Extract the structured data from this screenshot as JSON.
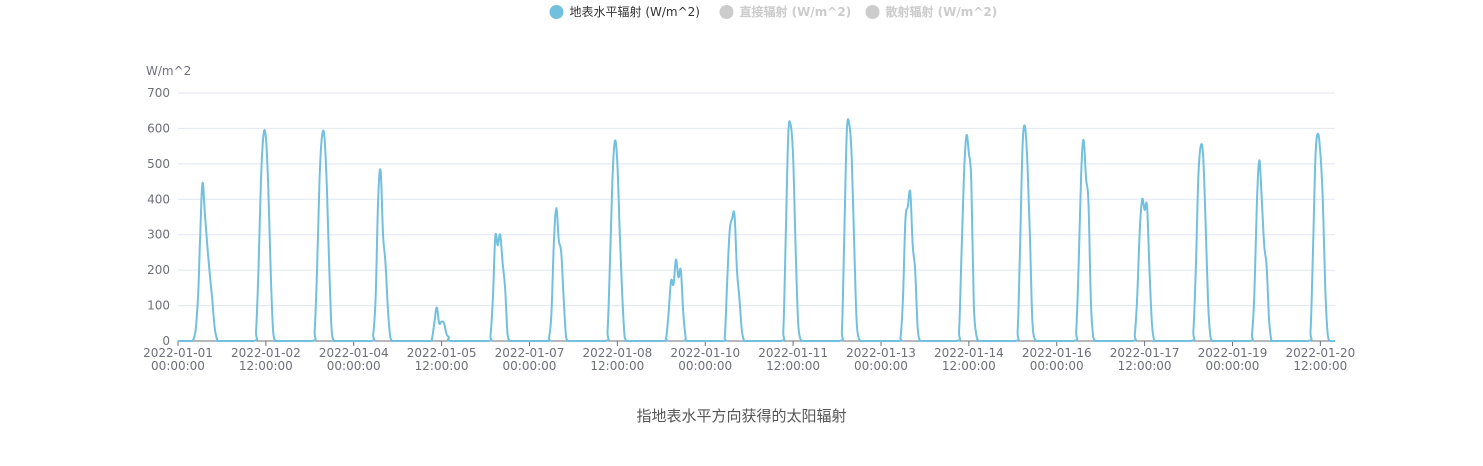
{
  "chart_data": {
    "type": "line",
    "y_axis_name": "W/m^2",
    "ylim": [
      0,
      700
    ],
    "y_ticks": [
      0,
      100,
      200,
      300,
      400,
      500,
      600,
      700
    ],
    "x_start": "2022-01-01 00:00:00",
    "x_end": "2022-01-20 18:00:00",
    "x_tick_labels": [
      [
        "2022-01-01",
        "00:00:00"
      ],
      [
        "2022-01-02",
        "12:00:00"
      ],
      [
        "2022-01-04",
        "00:00:00"
      ],
      [
        "2022-01-05",
        "12:00:00"
      ],
      [
        "2022-01-07",
        "00:00:00"
      ],
      [
        "2022-01-08",
        "12:00:00"
      ],
      [
        "2022-01-10",
        "00:00:00"
      ],
      [
        "2022-01-11",
        "12:00:00"
      ],
      [
        "2022-01-13",
        "00:00:00"
      ],
      [
        "2022-01-14",
        "12:00:00"
      ],
      [
        "2022-01-16",
        "00:00:00"
      ],
      [
        "2022-01-17",
        "12:00:00"
      ],
      [
        "2022-01-19",
        "00:00:00"
      ],
      [
        "2022-01-20",
        "12:00:00"
      ]
    ],
    "grid": true,
    "legend_position": "top-center",
    "series": [
      {
        "name": "地表水平辐射 (W/m^2)",
        "visible": true,
        "color": "#73c0de",
        "x": [
          "2022-01-01 00:00",
          "2022-01-01 06:00",
          "2022-01-01 08:00",
          "2022-01-01 09:00",
          "2022-01-01 10:00",
          "2022-01-01 11:00",
          "2022-01-01 12:00",
          "2022-01-01 13:00",
          "2022-01-01 14:00",
          "2022-01-01 15:00",
          "2022-01-01 16:00",
          "2022-01-01 17:00",
          "2022-01-02 07:00",
          "2022-01-02 08:00",
          "2022-01-02 09:00",
          "2022-01-02 10:00",
          "2022-01-02 11:00",
          "2022-01-02 12:00",
          "2022-01-02 13:00",
          "2022-01-02 14:00",
          "2022-01-02 15:00",
          "2022-01-02 16:00",
          "2022-01-02 17:00",
          "2022-01-03 07:00",
          "2022-01-03 08:00",
          "2022-01-03 09:00",
          "2022-01-03 10:00",
          "2022-01-03 11:00",
          "2022-01-03 12:00",
          "2022-01-03 13:00",
          "2022-01-03 14:00",
          "2022-01-03 15:00",
          "2022-01-03 16:00",
          "2022-01-03 17:00",
          "2022-01-04 07:00",
          "2022-01-04 08:00",
          "2022-01-04 09:00",
          "2022-01-04 10:00",
          "2022-01-04 11:00",
          "2022-01-04 12:00",
          "2022-01-04 13:00",
          "2022-01-04 14:00",
          "2022-01-04 15:00",
          "2022-01-04 16:00",
          "2022-01-04 17:00",
          "2022-01-05 07:00",
          "2022-01-05 08:00",
          "2022-01-05 09:00",
          "2022-01-05 10:00",
          "2022-01-05 11:00",
          "2022-01-05 12:00",
          "2022-01-05 13:00",
          "2022-01-05 14:00",
          "2022-01-05 15:00",
          "2022-01-05 16:00",
          "2022-01-06 07:00",
          "2022-01-06 08:00",
          "2022-01-06 09:00",
          "2022-01-06 10:00",
          "2022-01-06 11:00",
          "2022-01-06 12:00",
          "2022-01-06 13:00",
          "2022-01-06 14:00",
          "2022-01-06 15:00",
          "2022-01-06 16:00",
          "2022-01-06 17:00",
          "2022-01-07 07:00",
          "2022-01-07 08:00",
          "2022-01-07 09:00",
          "2022-01-07 10:00",
          "2022-01-07 11:00",
          "2022-01-07 12:00",
          "2022-01-07 13:00",
          "2022-01-07 14:00",
          "2022-01-07 15:00",
          "2022-01-07 16:00",
          "2022-01-07 17:00",
          "2022-01-08 07:00",
          "2022-01-08 08:00",
          "2022-01-08 09:00",
          "2022-01-08 10:00",
          "2022-01-08 11:00",
          "2022-01-08 12:00",
          "2022-01-08 13:00",
          "2022-01-08 14:00",
          "2022-01-08 15:00",
          "2022-01-08 16:00",
          "2022-01-08 17:00",
          "2022-01-09 07:00",
          "2022-01-09 08:00",
          "2022-01-09 09:00",
          "2022-01-09 10:00",
          "2022-01-09 11:00",
          "2022-01-09 12:00",
          "2022-01-09 13:00",
          "2022-01-09 14:00",
          "2022-01-09 15:00",
          "2022-01-09 16:00",
          "2022-01-09 17:00",
          "2022-01-10 07:00",
          "2022-01-10 08:00",
          "2022-01-10 09:00",
          "2022-01-10 10:00",
          "2022-01-10 11:00",
          "2022-01-10 12:00",
          "2022-01-10 13:00",
          "2022-01-10 14:00",
          "2022-01-10 15:00",
          "2022-01-10 16:00",
          "2022-01-10 17:00",
          "2022-01-11 07:00",
          "2022-01-11 08:00",
          "2022-01-11 09:00",
          "2022-01-11 10:00",
          "2022-01-11 11:00",
          "2022-01-11 12:00",
          "2022-01-11 13:00",
          "2022-01-11 14:00",
          "2022-01-11 15:00",
          "2022-01-11 16:00",
          "2022-01-11 17:00",
          "2022-01-12 07:00",
          "2022-01-12 08:00",
          "2022-01-12 09:00",
          "2022-01-12 10:00",
          "2022-01-12 11:00",
          "2022-01-12 12:00",
          "2022-01-12 13:00",
          "2022-01-12 14:00",
          "2022-01-12 15:00",
          "2022-01-12 16:00",
          "2022-01-12 17:00",
          "2022-01-13 07:00",
          "2022-01-13 08:00",
          "2022-01-13 09:00",
          "2022-01-13 10:00",
          "2022-01-13 11:00",
          "2022-01-13 12:00",
          "2022-01-13 13:00",
          "2022-01-13 14:00",
          "2022-01-13 15:00",
          "2022-01-13 16:00",
          "2022-01-13 17:00",
          "2022-01-14 07:00",
          "2022-01-14 08:00",
          "2022-01-14 09:00",
          "2022-01-14 10:00",
          "2022-01-14 11:00",
          "2022-01-14 12:00",
          "2022-01-14 13:00",
          "2022-01-14 14:00",
          "2022-01-14 15:00",
          "2022-01-14 16:00",
          "2022-01-14 17:00",
          "2022-01-15 07:00",
          "2022-01-15 08:00",
          "2022-01-15 09:00",
          "2022-01-15 10:00",
          "2022-01-15 11:00",
          "2022-01-15 12:00",
          "2022-01-15 13:00",
          "2022-01-15 14:00",
          "2022-01-15 15:00",
          "2022-01-15 16:00",
          "2022-01-15 17:00",
          "2022-01-16 07:00",
          "2022-01-16 08:00",
          "2022-01-16 09:00",
          "2022-01-16 10:00",
          "2022-01-16 11:00",
          "2022-01-16 12:00",
          "2022-01-16 13:00",
          "2022-01-16 14:00",
          "2022-01-16 15:00",
          "2022-01-16 16:00",
          "2022-01-16 17:00",
          "2022-01-17 07:00",
          "2022-01-17 08:00",
          "2022-01-17 09:00",
          "2022-01-17 10:00",
          "2022-01-17 11:00",
          "2022-01-17 12:00",
          "2022-01-17 13:00",
          "2022-01-17 14:00",
          "2022-01-17 15:00",
          "2022-01-17 16:00",
          "2022-01-17 17:00",
          "2022-01-18 07:00",
          "2022-01-18 08:00",
          "2022-01-18 09:00",
          "2022-01-18 10:00",
          "2022-01-18 11:00",
          "2022-01-18 12:00",
          "2022-01-18 13:00",
          "2022-01-18 14:00",
          "2022-01-18 15:00",
          "2022-01-18 16:00",
          "2022-01-18 17:00",
          "2022-01-19 07:00",
          "2022-01-19 08:00",
          "2022-01-19 09:00",
          "2022-01-19 10:00",
          "2022-01-19 11:00",
          "2022-01-19 12:00",
          "2022-01-19 13:00",
          "2022-01-19 14:00",
          "2022-01-19 15:00",
          "2022-01-19 16:00",
          "2022-01-19 17:00",
          "2022-01-20 07:00",
          "2022-01-20 08:00",
          "2022-01-20 09:00",
          "2022-01-20 10:00",
          "2022-01-20 11:00",
          "2022-01-20 12:00",
          "2022-01-20 13:00",
          "2022-01-20 14:00",
          "2022-01-20 15:00",
          "2022-01-20 16:00",
          "2022-01-20 18:00"
        ],
        "values": [
          0,
          0,
          100,
          280,
          445,
          360,
          270,
          190,
          120,
          40,
          5,
          0,
          0,
          30,
          210,
          455,
          580,
          575,
          430,
          190,
          25,
          0,
          0,
          0,
          30,
          210,
          460,
          578,
          575,
          430,
          200,
          25,
          0,
          0,
          0,
          20,
          130,
          400,
          480,
          300,
          220,
          90,
          10,
          0,
          0,
          0,
          5,
          50,
          95,
          50,
          55,
          50,
          20,
          10,
          0,
          0,
          15,
          120,
          295,
          270,
          300,
          220,
          150,
          20,
          0,
          0,
          0,
          10,
          80,
          280,
          375,
          285,
          250,
          120,
          10,
          0,
          0,
          0,
          30,
          230,
          460,
          565,
          500,
          300,
          130,
          10,
          0,
          0,
          0,
          10,
          80,
          170,
          160,
          230,
          180,
          200,
          80,
          10,
          0,
          0,
          10,
          170,
          310,
          345,
          355,
          200,
          120,
          30,
          0,
          0,
          0,
          30,
          300,
          580,
          610,
          520,
          270,
          60,
          5,
          0,
          0,
          0,
          30,
          310,
          590,
          612,
          520,
          280,
          60,
          5,
          0,
          0,
          0,
          10,
          120,
          340,
          380,
          420,
          270,
          200,
          40,
          0,
          0,
          0,
          30,
          250,
          470,
          580,
          530,
          450,
          110,
          20,
          0,
          0,
          0,
          30,
          270,
          550,
          605,
          500,
          300,
          60,
          5,
          0,
          0,
          0,
          30,
          220,
          470,
          568,
          460,
          390,
          110,
          10,
          0,
          0,
          0,
          20,
          130,
          310,
          400,
          370,
          380,
          200,
          50,
          0,
          0,
          0,
          30,
          210,
          460,
          550,
          520,
          330,
          110,
          10,
          0,
          0,
          0,
          20,
          140,
          390,
          510,
          400,
          270,
          210,
          60,
          0,
          0,
          0,
          30,
          260,
          520,
          585,
          530,
          400,
          150,
          20,
          0,
          0
        ]
      },
      {
        "name": "直接辐射 (W/m^2)",
        "visible": false,
        "color": "#cccccc",
        "x": [],
        "values": []
      },
      {
        "name": "散射辐射 (W/m^2)",
        "visible": false,
        "color": "#cccccc",
        "x": [],
        "values": []
      }
    ]
  },
  "caption": "指地表水平方向获得的太阳辐射"
}
